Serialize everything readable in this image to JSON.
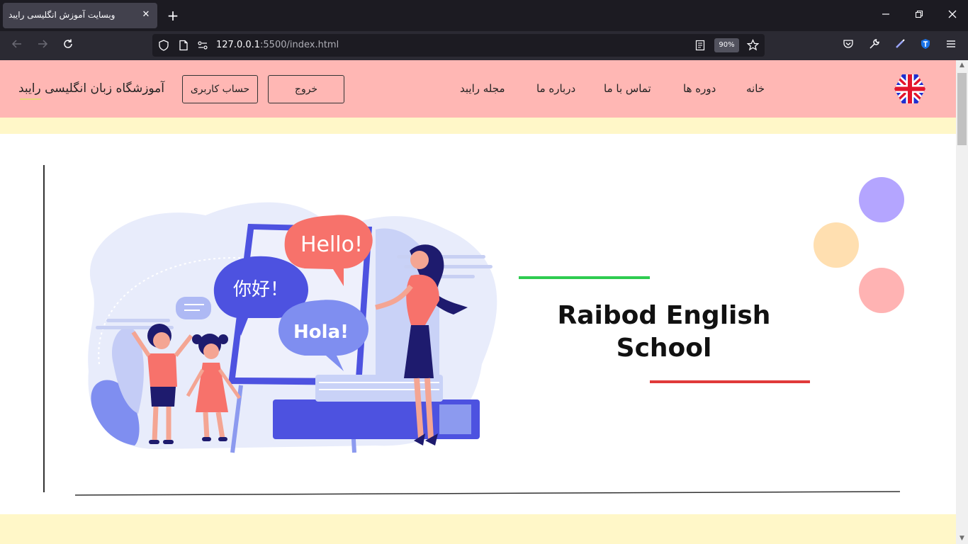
{
  "browser": {
    "tab_title": "وبسایت آموزش انگلیسی رایبد",
    "tab_close": "✕",
    "new_tab": "+",
    "url_host": "127.0.0.1",
    "url_rest": ":5500/index.html",
    "zoom": "90%"
  },
  "site": {
    "brand": "آموزشگاه زبان انگلیسی رایبد",
    "nav": {
      "home": "خانه",
      "courses": "دوره ها",
      "contact": "تماس با ما",
      "about": "درباره ما",
      "magazine": "مجله رایبد"
    },
    "buttons": {
      "logout": "خروج",
      "account": "حساب کاربری"
    },
    "hero": {
      "title_line1": "Raibod English",
      "title_line2": "School",
      "bubble_hello": "Hello!",
      "bubble_nihao": "你好！",
      "bubble_hola": "Hola!"
    }
  },
  "colors": {
    "header_bg": "#ffb7b4",
    "page_bg": "#fff7c8",
    "accent_green": "#2ecc50",
    "accent_red": "#e03a3a",
    "circle_purple": "#b4a5ff",
    "circle_orange": "#ffdfb0",
    "circle_pink": "#ffb3b3"
  }
}
